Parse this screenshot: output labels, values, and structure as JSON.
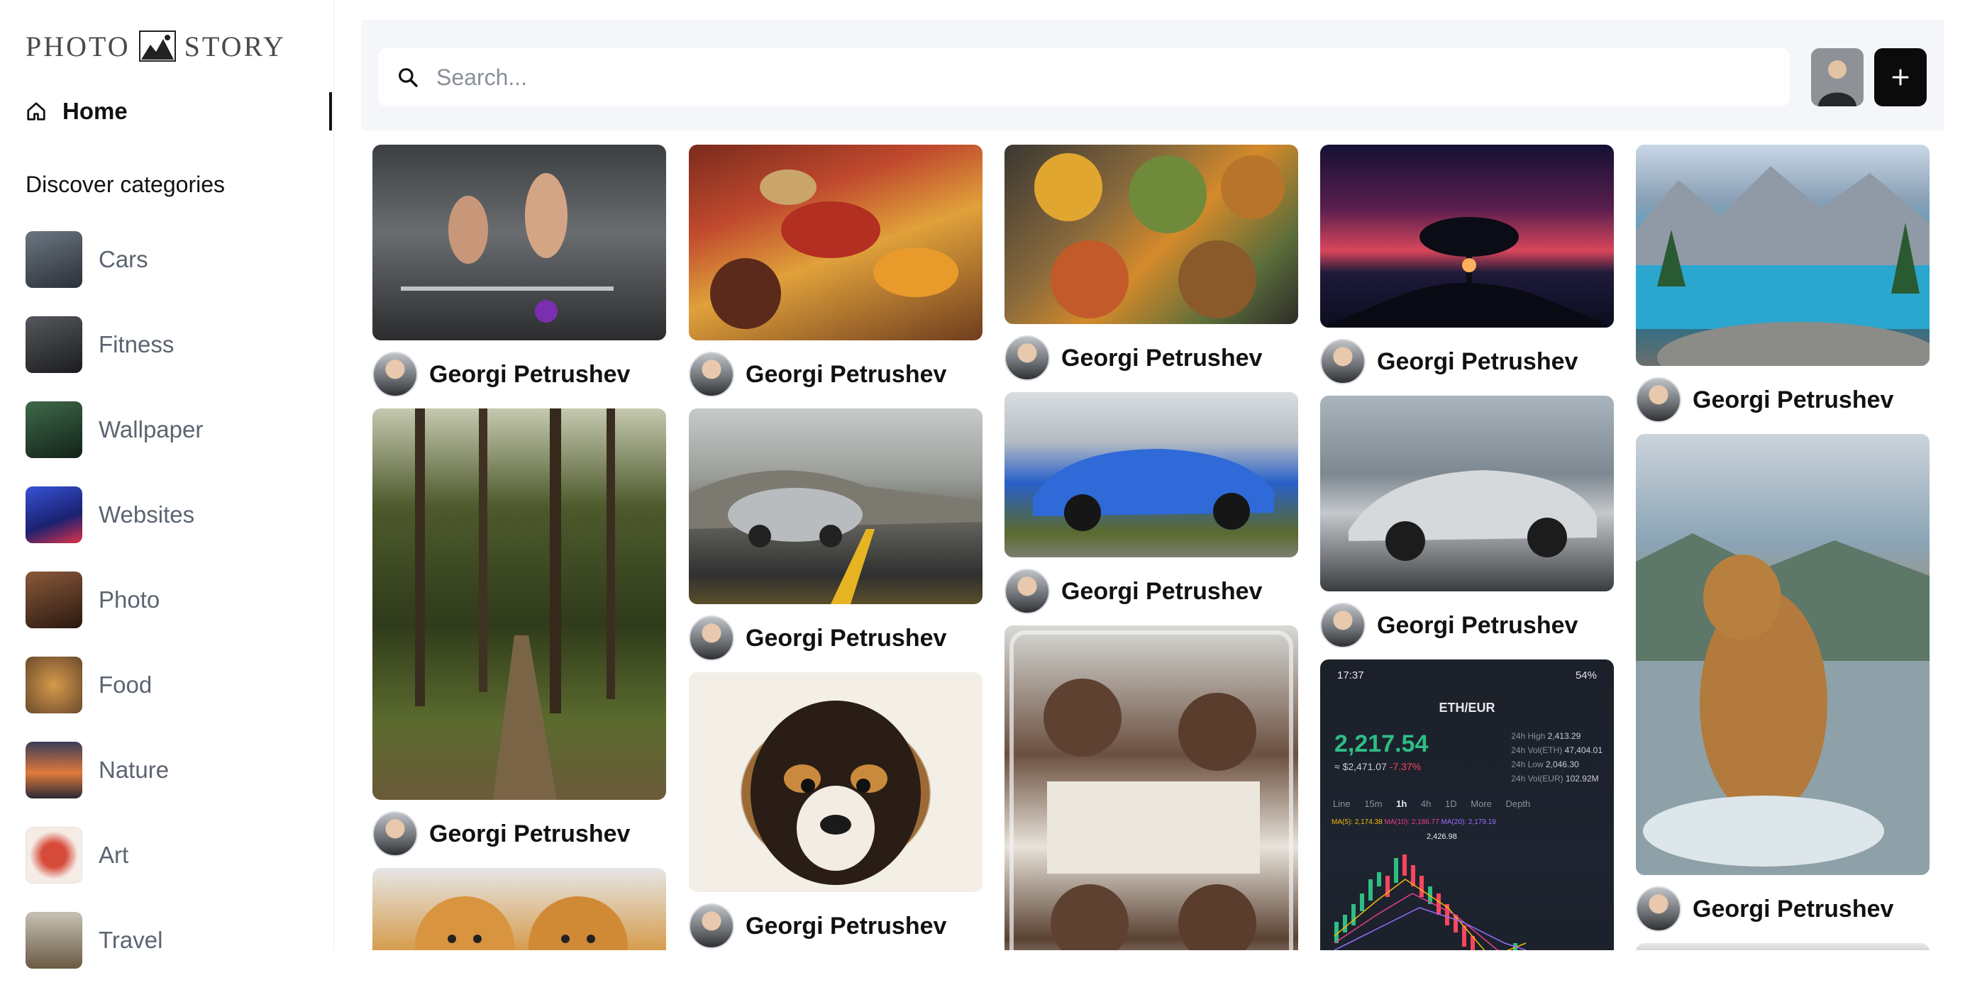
{
  "app": {
    "logo_left": "PHOTO",
    "logo_right": "STORY"
  },
  "sidebar": {
    "home_label": "Home",
    "discover_title": "Discover categories",
    "categories": [
      {
        "label": "Cars",
        "color": "#3b4552"
      },
      {
        "label": "Fitness",
        "color": "#2e2f33"
      },
      {
        "label": "Wallpaper",
        "color": "#24402e"
      },
      {
        "label": "Websites",
        "color": "#2a3fae"
      },
      {
        "label": "Photo",
        "color": "#5a3524"
      },
      {
        "label": "Food",
        "color": "#a06a3a"
      },
      {
        "label": "Nature",
        "color": "#c9603a"
      },
      {
        "label": "Art",
        "color": "#c23a3a"
      },
      {
        "label": "Travel",
        "color": "#8a7a60"
      }
    ]
  },
  "search": {
    "placeholder": "Search..."
  },
  "feed": {
    "author": "Georgi Petrushev",
    "posts": [
      {
        "image": "gym workout"
      },
      {
        "image": "meat and vegetables"
      },
      {
        "image": "food bowls"
      },
      {
        "image": "tree at sunset"
      },
      {
        "image": "mountain lake"
      },
      {
        "image": "forest path"
      },
      {
        "image": "silver sedan on road"
      },
      {
        "image": "blue sports car"
      },
      {
        "image": "silver hypercar"
      },
      {
        "image": "dog in water"
      },
      {
        "image": "puppy"
      },
      {
        "image": "meatballs and rice"
      },
      {
        "image": "crypto chart"
      },
      {
        "image": "pomeranian dogs"
      },
      {
        "image": "car"
      }
    ]
  },
  "crypto_screenshot": {
    "time": "17:37",
    "battery": "54%",
    "pair": "ETH/EUR",
    "price": "2,217.54",
    "sub_price": "≈ $2,471.07",
    "change": "-7.37%",
    "stats": [
      {
        "label": "24h High",
        "value": "2,413.29"
      },
      {
        "label": "24h Vol(ETH)",
        "value": "47,404.01"
      },
      {
        "label": "24h Low",
        "value": "2,046.30"
      },
      {
        "label": "24h Vol(EUR)",
        "value": "102.92M"
      }
    ],
    "tabs": [
      "Line",
      "15m",
      "1h",
      "4h",
      "1D",
      "More",
      "Depth"
    ],
    "ma": [
      "MA(5): 2,174.38",
      "MA(10): 2,186.77",
      "MA(20): 2,179.19"
    ],
    "high_label": "2,426.98"
  }
}
